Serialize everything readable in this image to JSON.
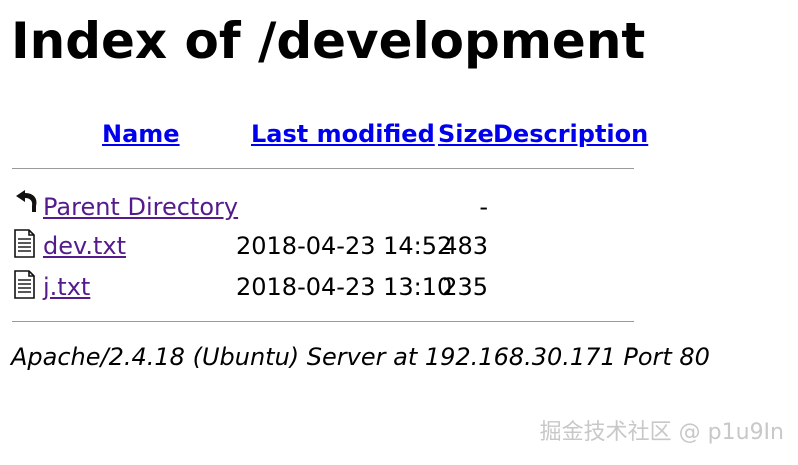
{
  "page": {
    "title": "Index of /development"
  },
  "columns": {
    "name": "Name",
    "last_modified": "Last modified",
    "size": "Size",
    "description": "Description"
  },
  "rows": [
    {
      "icon": "back-arrow-icon",
      "name": "Parent Directory",
      "modified": "",
      "size": "-"
    },
    {
      "icon": "text-file-icon",
      "name": "dev.txt",
      "modified": "2018-04-23 14:52",
      "size": "483"
    },
    {
      "icon": "text-file-icon",
      "name": "j.txt",
      "modified": "2018-04-23 13:10",
      "size": "235"
    }
  ],
  "footer": {
    "server_signature": "Apache/2.4.18 (Ubuntu) Server at 192.168.30.171 Port 80"
  },
  "watermark": "掘金技术社区 @ p1u9In",
  "colors": {
    "link": "#0000ee",
    "visited_link": "#551a8b",
    "rule": "#999999",
    "watermark": "#c8c8c8"
  }
}
